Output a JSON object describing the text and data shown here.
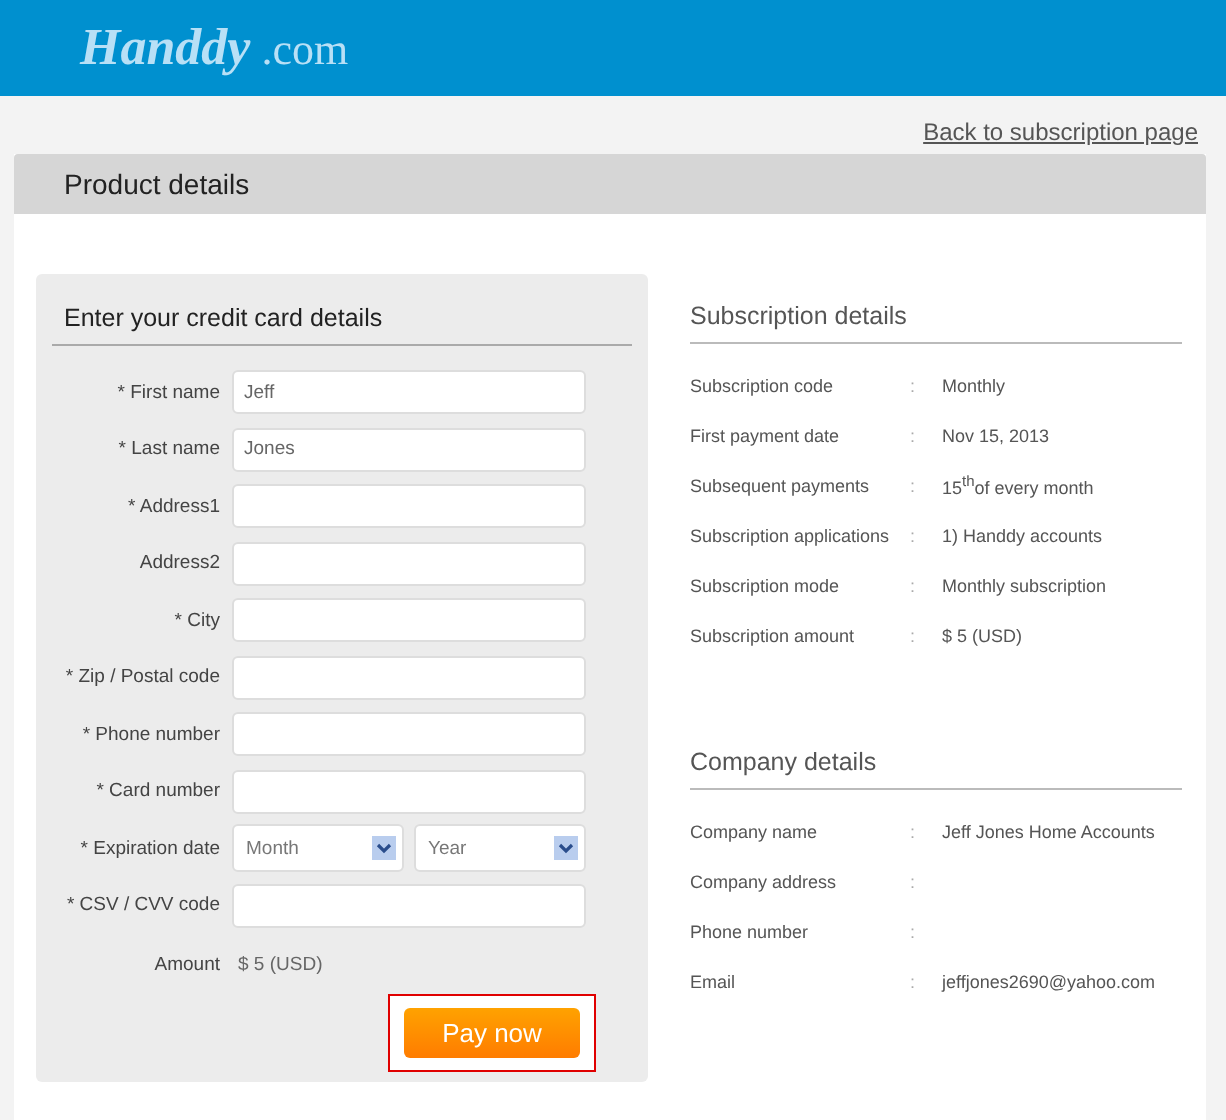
{
  "header": {
    "logo_name": "Handdy",
    "logo_suffix": ".com"
  },
  "back_link": "Back to subscription page",
  "panel": {
    "title": "Product details"
  },
  "form": {
    "title": "Enter your credit card details",
    "fields": [
      {
        "kind": "text",
        "label": "* First name",
        "value": "Jeff"
      },
      {
        "kind": "text",
        "label": "* Last name",
        "value": "Jones"
      },
      {
        "kind": "text",
        "label": "* Address1"
      },
      {
        "kind": "text",
        "label": "Address2"
      },
      {
        "kind": "text",
        "label": "* City"
      },
      {
        "kind": "text",
        "label": "* Zip / Postal code"
      },
      {
        "kind": "text",
        "label": "* Phone number"
      },
      {
        "kind": "text",
        "label": "* Card number"
      },
      {
        "kind": "dropdowns",
        "label": "* Expiration date",
        "dropdowns": [
          {
            "value": "Month"
          },
          {
            "value": "Year"
          }
        ]
      },
      {
        "kind": "text",
        "label": "* CSV / CVV code"
      },
      {
        "kind": "static",
        "label": "Amount",
        "value": "$ 5 (USD)"
      }
    ],
    "submit": "Pay now"
  },
  "sections": [
    {
      "title": "Subscription details",
      "rows": [
        {
          "label": "Subscription code",
          "separator": ":",
          "value": "Monthly"
        },
        {
          "label": "First payment date",
          "separator": ":",
          "value": "Nov 15, 2013"
        },
        {
          "label": "Subsequent payments",
          "separator": ":",
          "value": "15$^{th}$of every month"
        },
        {
          "label": "Subscription applications",
          "separator": ":",
          "value": "1) Handdy accounts"
        },
        {
          "label": "Subscription mode",
          "separator": ":",
          "value": "Monthly subscription"
        },
        {
          "label": "Subscription amount",
          "separator": ":",
          "value": "$ 5 (USD)"
        }
      ]
    },
    {
      "title": "Company details",
      "rows": [
        {
          "label": "Company name",
          "separator": ":",
          "value": "Jeff Jones Home Accounts"
        },
        {
          "label": "Company address",
          "separator": ":"
        },
        {
          "label": "Phone number",
          "separator": ":"
        },
        {
          "label": "Email",
          "separator": ":",
          "value": "jeffjones2690@yahoo.com"
        }
      ]
    }
  ]
}
